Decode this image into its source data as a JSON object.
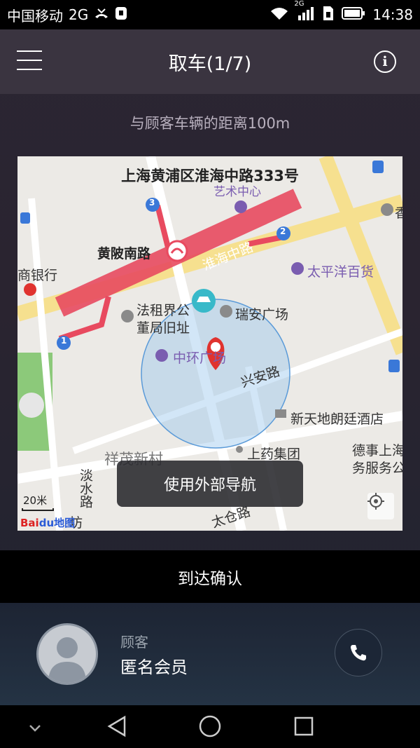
{
  "status_bar": {
    "carrier": "中国移动",
    "network": "2G",
    "network_small": "2G",
    "time": "14:38",
    "icons": [
      "missed-call-icon",
      "notification-icon",
      "wifi-icon",
      "signal-icon",
      "sim-icon",
      "battery-icon"
    ]
  },
  "header": {
    "title": "取车(1/7)",
    "menu_icon": "hamburger-menu-icon",
    "info_icon": "info-icon",
    "info_glyph": "i"
  },
  "distance_text": "与顾客车辆的距离100m",
  "map": {
    "address": "上海黄浦区淮海中路333号",
    "labels": {
      "station": "黄陂南路",
      "road_huaihai": "淮海中路",
      "pacific": "太平洋百货",
      "bank": "商银行",
      "french": "法租界公",
      "french2": "董局旧址",
      "ruian": "瑞安广场",
      "zhonghuan": "中环广场",
      "xingan": "兴安路",
      "xintiandi": "新天地朗廷酒店",
      "shangyao": "上药集团",
      "xiangmao": "祥茂新村",
      "dese": "德事上海",
      "dese2": "务服务公",
      "danshui": "淡水路",
      "taicang": "太仓路",
      "art": "艺术中心",
      "fang": "坊",
      "xiang": "香"
    },
    "metro_badges": [
      "1",
      "2",
      "3"
    ],
    "scale_text": "20米",
    "logo_text": "Bai",
    "logo_text2": "du地图",
    "external_nav_label": "使用外部导航"
  },
  "arrive_button": "到达确认",
  "customer": {
    "role": "顾客",
    "name": "匿名会员"
  },
  "nav_bar": {
    "icons": [
      "collapse-icon",
      "back-icon",
      "home-icon",
      "recents-icon"
    ]
  },
  "colors": {
    "header_bg": "#3a3440",
    "metro_line": "#e84a5f",
    "road_yellow": "#f6e08f",
    "pin_red": "#e0332f",
    "radius_blue": "#9cc7ee"
  }
}
